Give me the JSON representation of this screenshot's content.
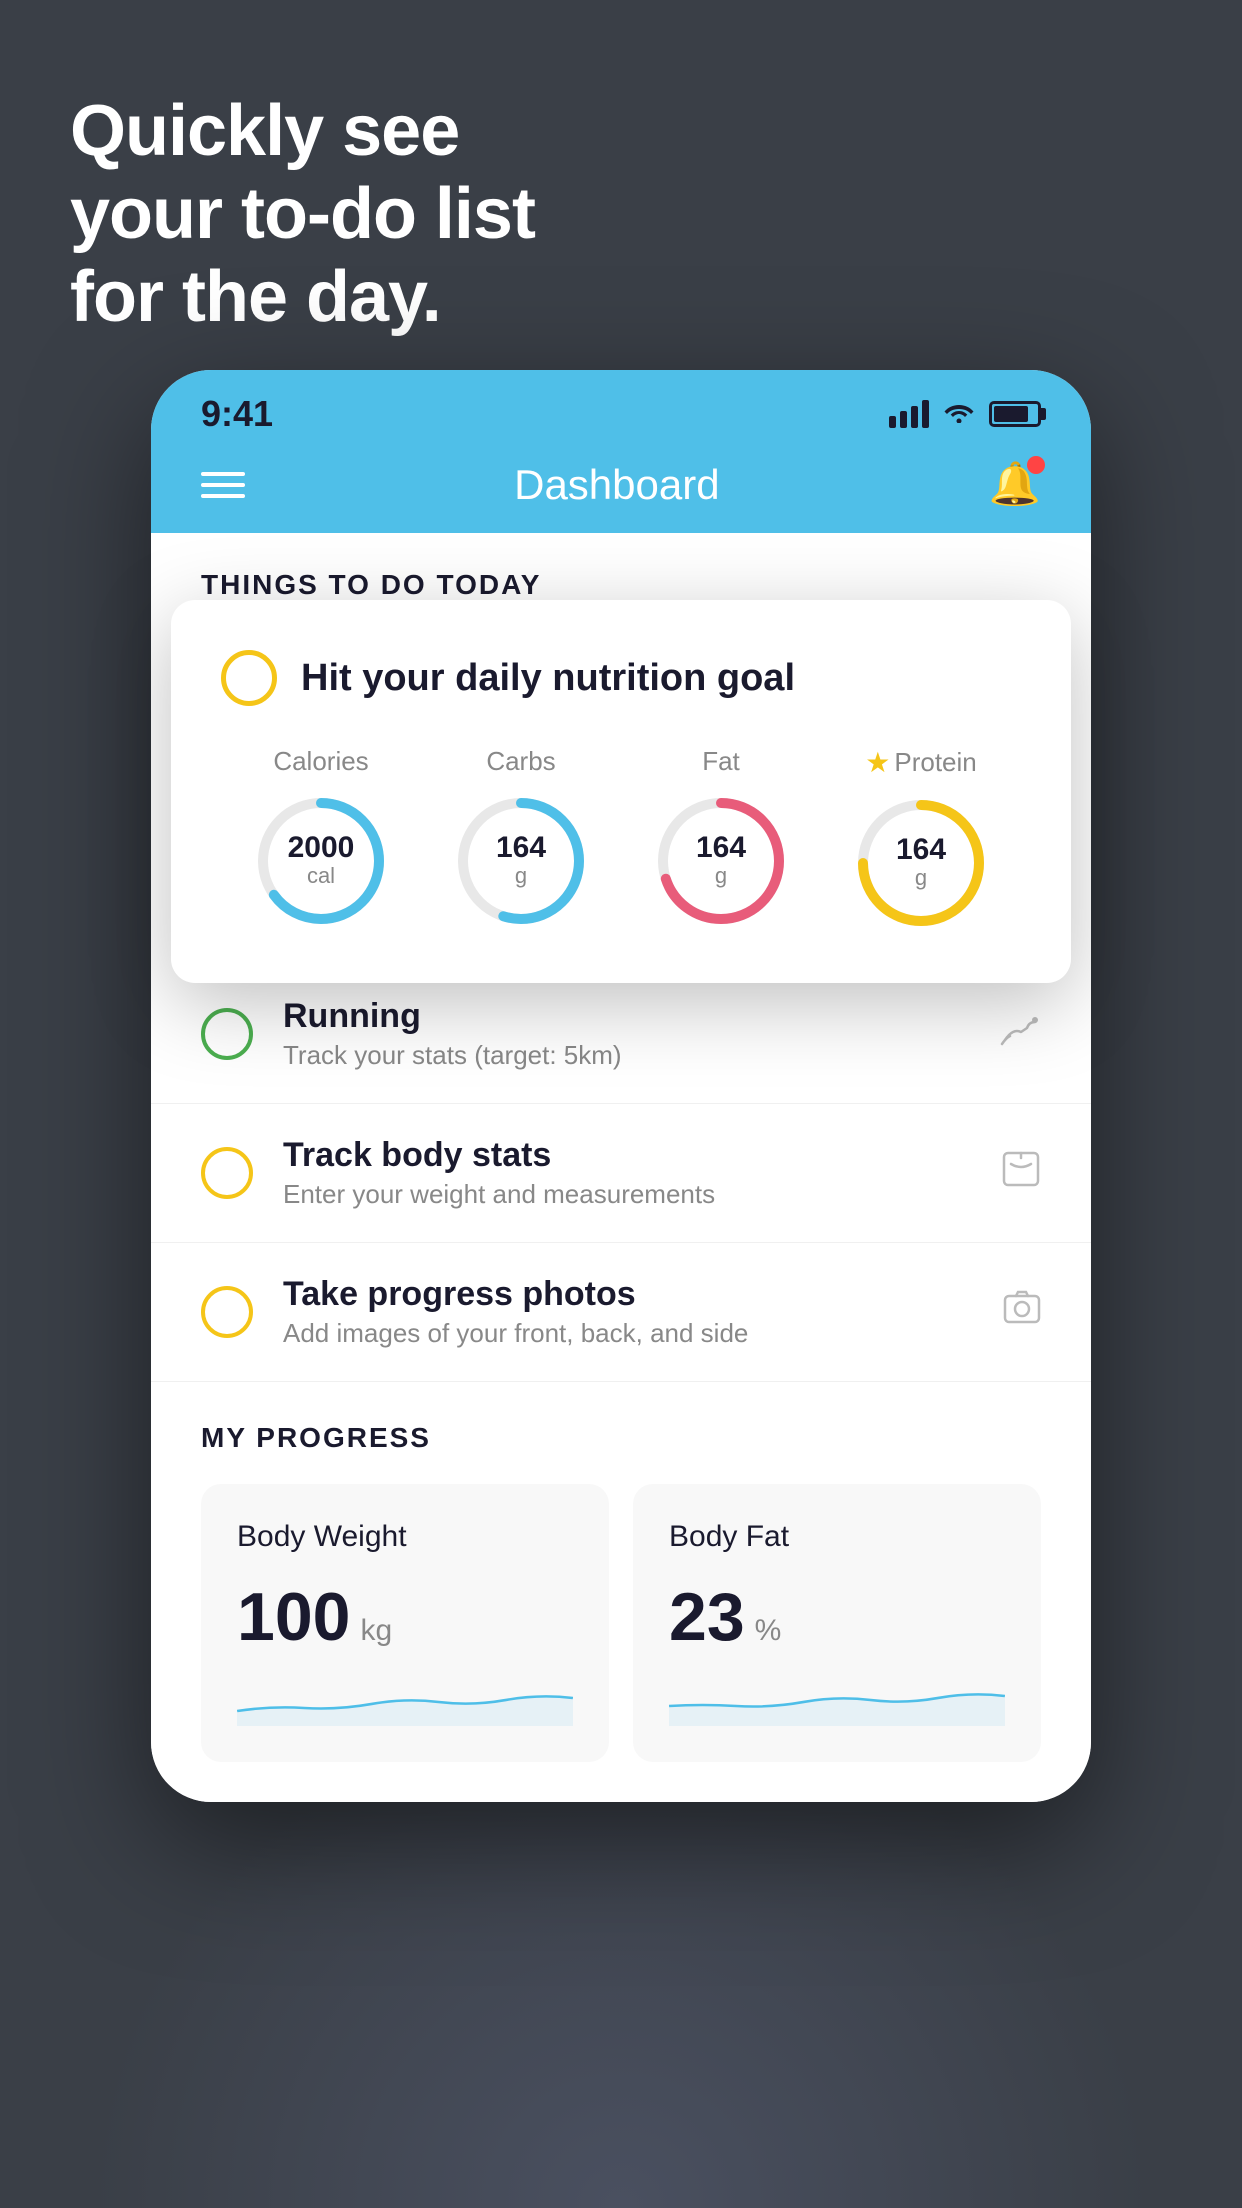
{
  "background": {
    "color": "#3a3f47"
  },
  "headline": {
    "line1": "Quickly see",
    "line2": "your to-do list",
    "line3": "for the day."
  },
  "phone": {
    "status_bar": {
      "time": "9:41"
    },
    "nav": {
      "title": "Dashboard"
    },
    "section_today": {
      "title": "THINGS TO DO TODAY"
    },
    "floating_card": {
      "indicator_color": "#f5c518",
      "title": "Hit your daily nutrition goal",
      "nutrition": [
        {
          "label": "Calories",
          "value": "2000",
          "unit": "cal",
          "color": "#4fbfe8",
          "percent": 65
        },
        {
          "label": "Carbs",
          "value": "164",
          "unit": "g",
          "color": "#4fbfe8",
          "percent": 55
        },
        {
          "label": "Fat",
          "value": "164",
          "unit": "g",
          "color": "#e85c7a",
          "percent": 70
        },
        {
          "label": "Protein",
          "value": "164",
          "unit": "g",
          "color": "#f5c518",
          "percent": 75,
          "starred": true
        }
      ]
    },
    "todo_items": [
      {
        "id": "running",
        "label": "Running",
        "sublabel": "Track your stats (target: 5km)",
        "circle_color": "green",
        "icon": "🏃"
      },
      {
        "id": "body-stats",
        "label": "Track body stats",
        "sublabel": "Enter your weight and measurements",
        "circle_color": "yellow",
        "icon": "⚖️"
      },
      {
        "id": "progress-photos",
        "label": "Take progress photos",
        "sublabel": "Add images of your front, back, and side",
        "circle_color": "yellow",
        "icon": "🖼️"
      }
    ],
    "progress": {
      "title": "MY PROGRESS",
      "cards": [
        {
          "id": "body-weight",
          "title": "Body Weight",
          "value": "100",
          "unit": "kg"
        },
        {
          "id": "body-fat",
          "title": "Body Fat",
          "value": "23",
          "unit": "%"
        }
      ]
    }
  }
}
